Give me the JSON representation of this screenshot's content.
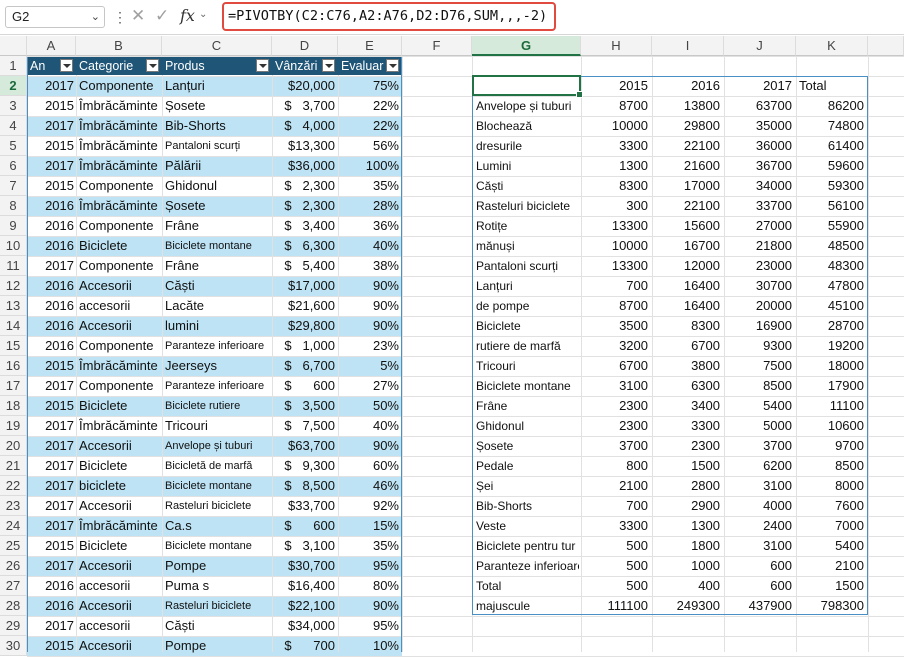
{
  "formula_bar": {
    "name_box": "G2",
    "name_box_dropdown_icon": "chevron-down-icon",
    "more_icon": "vertical-ellipsis-icon",
    "cancel_icon": "close-icon",
    "enter_icon": "check-icon",
    "function_icon": "fx",
    "formula": "=PIVOTBY(C2:C76,A2:A76,D2:D76,SUM,,,-2)"
  },
  "grid": {
    "columns": [
      "A",
      "B",
      "C",
      "D",
      "E",
      "F",
      "G",
      "H",
      "I",
      "J",
      "K"
    ],
    "rows": [
      "1",
      "2",
      "3",
      "4",
      "5",
      "6",
      "7",
      "8",
      "9",
      "10",
      "11",
      "12",
      "13",
      "14",
      "15",
      "16",
      "17",
      "18",
      "19",
      "20",
      "21",
      "22",
      "23",
      "24",
      "25",
      "26",
      "27",
      "28",
      "29",
      "30"
    ],
    "selected_column": "G",
    "selected_row": "2"
  },
  "colors": {
    "accent": "#217346",
    "table_header": "#1f5577",
    "band": "#bde3f4",
    "highlight_box": "#e04a3f"
  },
  "table": {
    "headers": [
      "An",
      "Categorie",
      "Produs",
      "Vânzări",
      "Evaluar"
    ],
    "rows": [
      [
        "2017",
        "Componente",
        "Lanțuri",
        "$20,000",
        "75%"
      ],
      [
        "2015",
        "Îmbrăcăminte",
        "Șosete",
        "$   3,700",
        "22%"
      ],
      [
        "2017",
        "Îmbrăcăminte",
        "Bib-Shorts",
        "$   4,000",
        "22%"
      ],
      [
        "2015",
        "Îmbrăcăminte",
        "Pantaloni scurți",
        "$13,300",
        "56%"
      ],
      [
        "2017",
        "Îmbrăcăminte",
        "Pălării",
        "$36,000",
        "100%"
      ],
      [
        "2015",
        "Componente",
        "Ghidonul",
        "$   2,300",
        "35%"
      ],
      [
        "2016",
        "Îmbrăcăminte",
        "Șosete",
        "$   2,300",
        "28%"
      ],
      [
        "2016",
        "Componente",
        "Frâne",
        "$   3,400",
        "36%"
      ],
      [
        "2016",
        "Biciclete",
        "Biciclete montane",
        "$   6,300",
        "40%"
      ],
      [
        "2017",
        "Componente",
        "Frâne",
        "$   5,400",
        "38%"
      ],
      [
        "2016",
        "Accesorii",
        "Căști",
        "$17,000",
        "90%"
      ],
      [
        "2016",
        "accesorii",
        "Lacăte",
        "$21,600",
        "90%"
      ],
      [
        "2016",
        "Accesorii",
        "lumini",
        "$29,800",
        "90%"
      ],
      [
        "2016",
        "Componente",
        "Paranteze inferioare",
        "$   1,000",
        "23%"
      ],
      [
        "2015",
        "Îmbrăcăminte",
        "Jeerseys",
        "$   6,700",
        "5%"
      ],
      [
        "2017",
        "Componente",
        "Paranteze inferioare",
        "$      600",
        "27%"
      ],
      [
        "2015",
        "Biciclete",
        "Biciclete rutiere",
        "$   3,500",
        "50%"
      ],
      [
        "2017",
        "Îmbrăcăminte",
        "Tricouri",
        "$   7,500",
        "40%"
      ],
      [
        "2017",
        "Accesorii",
        "Anvelope și tuburi",
        "$63,700",
        "90%"
      ],
      [
        "2017",
        "Biciclete",
        "Bicicletă de marfă",
        "$   9,300",
        "60%"
      ],
      [
        "2017",
        "biciclete",
        "Biciclete montane",
        "$   8,500",
        "46%"
      ],
      [
        "2017",
        "Accesorii",
        "Rasteluri biciclete",
        "$33,700",
        "92%"
      ],
      [
        "2017",
        "Îmbrăcăminte",
        "Ca.s",
        "$      600",
        "15%"
      ],
      [
        "2015",
        "Biciclete",
        "Biciclete montane",
        "$   3,100",
        "35%"
      ],
      [
        "2017",
        "Accesorii",
        "Pompe",
        "$30,700",
        "95%"
      ],
      [
        "2016",
        "accesorii",
        "Puma s",
        "$16,400",
        "80%"
      ],
      [
        "2016",
        "Accesorii",
        "Rasteluri biciclete",
        "$22,100",
        "90%"
      ],
      [
        "2017",
        "accesorii",
        "Căști",
        "$34,000",
        "95%"
      ],
      [
        "2015",
        "Accesorii",
        "Pompe",
        "$      700",
        "10%"
      ]
    ]
  },
  "pivot": {
    "headers": [
      "",
      "2015",
      "2016",
      "2017",
      "Total"
    ],
    "rows": [
      [
        "Anvelope și tuburi",
        "8700",
        "13800",
        "63700",
        "86200"
      ],
      [
        "Blochează",
        "10000",
        "29800",
        "35000",
        "74800"
      ],
      [
        "dresurile",
        "3300",
        "22100",
        "36000",
        "61400"
      ],
      [
        "Lumini",
        "1300",
        "21600",
        "36700",
        "59600"
      ],
      [
        "Căști",
        "8300",
        "17000",
        "34000",
        "59300"
      ],
      [
        "Rasteluri biciclete",
        "300",
        "22100",
        "33700",
        "56100"
      ],
      [
        "Rotițe",
        "13300",
        "15600",
        "27000",
        "55900"
      ],
      [
        "mănuși",
        "10000",
        "16700",
        "21800",
        "48500"
      ],
      [
        "Pantaloni scurți",
        "13300",
        "12000",
        "23000",
        "48300"
      ],
      [
        "Lanțuri",
        "700",
        "16400",
        "30700",
        "47800"
      ],
      [
        "de pompe",
        "8700",
        "16400",
        "20000",
        "45100"
      ],
      [
        "Biciclete",
        "3500",
        "8300",
        "16900",
        "28700"
      ],
      [
        "rutiere de marfă",
        "3200",
        "6700",
        "9300",
        "19200"
      ],
      [
        "Tricouri",
        "6700",
        "3800",
        "7500",
        "18000"
      ],
      [
        "Biciclete montane",
        "3100",
        "6300",
        "8500",
        "17900"
      ],
      [
        "Frâne",
        "2300",
        "3400",
        "5400",
        "11100"
      ],
      [
        "Ghidonul",
        "2300",
        "3300",
        "5000",
        "10600"
      ],
      [
        "Șosete",
        "3700",
        "2300",
        "3700",
        "9700"
      ],
      [
        "Pedale",
        "800",
        "1500",
        "6200",
        "8500"
      ],
      [
        "Șei",
        "2100",
        "2800",
        "3100",
        "8000"
      ],
      [
        "Bib-Shorts",
        "700",
        "2900",
        "4000",
        "7600"
      ],
      [
        "Veste",
        "3300",
        "1300",
        "2400",
        "7000"
      ],
      [
        "Biciclete pentru tur",
        "500",
        "1800",
        "3100",
        "5400"
      ],
      [
        "Paranteze inferioare",
        "500",
        "1000",
        "600",
        "2100"
      ],
      [
        "Total",
        "500",
        "400",
        "600",
        "1500"
      ],
      [
        "majuscule",
        "111100",
        "249300",
        "437900",
        "798300"
      ]
    ]
  }
}
